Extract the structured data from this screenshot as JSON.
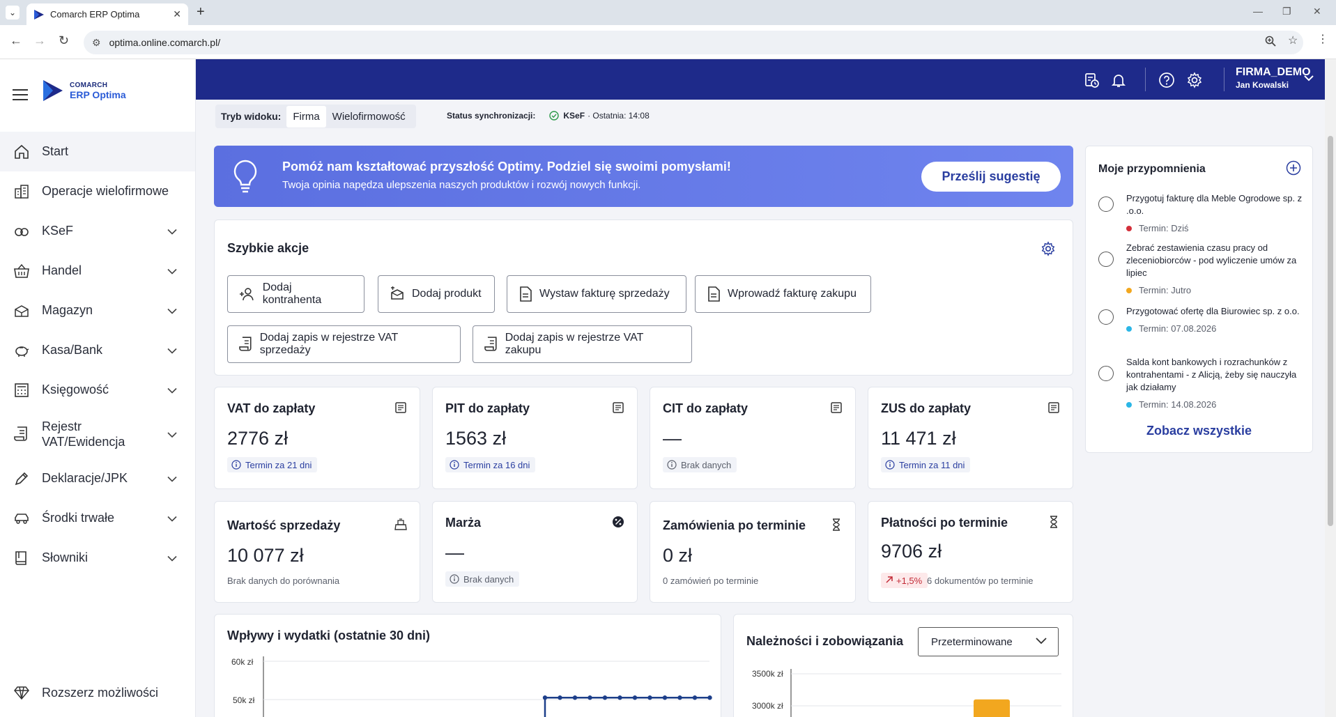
{
  "browser": {
    "tab_title": "Comarch ERP Optima",
    "url": "optima.online.comarch.pl/"
  },
  "logo": {
    "brand": "COMARCH",
    "product": "ERP Optima"
  },
  "sidebar": {
    "items": [
      {
        "label": "Start",
        "icon": "home-icon"
      },
      {
        "label": "Operacje wielofirmowe",
        "icon": "buildings-icon"
      },
      {
        "label": "KSeF",
        "icon": "ksef-icon"
      },
      {
        "label": "Handel",
        "icon": "basket-icon"
      },
      {
        "label": "Magazyn",
        "icon": "boxes-icon"
      },
      {
        "label": "Kasa/Bank",
        "icon": "piggybank-icon"
      },
      {
        "label": "Księgowość",
        "icon": "calculator-icon"
      },
      {
        "label": "Rejestr VAT/Ewidencja",
        "icon": "register-icon"
      },
      {
        "label": "Deklaracje/JPK",
        "icon": "pen-icon"
      },
      {
        "label": "Środki trwałe",
        "icon": "car-icon"
      },
      {
        "label": "Słowniki",
        "icon": "book-icon"
      }
    ],
    "bottom": "Rozszerz możliwości"
  },
  "header": {
    "company": "FIRMA_DEMO",
    "user": "Jan Kowalski"
  },
  "subheader": {
    "view_label": "Tryb widoku:",
    "view_options": [
      "Firma",
      "Wielofirmowość"
    ],
    "sync_label": "Status synchronizacji:",
    "sync_source": "KSeF",
    "sync_time": "· Ostatnia: 14:08"
  },
  "banner": {
    "title": "Pomóż nam kształtować przyszłość Optimy. Podziel się swoimi pomysłami!",
    "subtitle": "Twoja opinia napędza ulepszenia naszych produktów i rozwój nowych funkcji.",
    "cta": "Prześlij sugestię"
  },
  "quick_actions": {
    "title": "Szybkie akcje",
    "buttons": [
      "Dodaj kontrahenta",
      "Dodaj produkt",
      "Wystaw fakturę sprzedaży",
      "Wprowadź fakturę zakupu",
      "Dodaj zapis w rejestrze VAT sprzedaży",
      "Dodaj zapis w rejestrze VAT zakupu"
    ]
  },
  "kpis": [
    {
      "title": "VAT do zapłaty",
      "value": "2776 zł",
      "note": "Termin za 21 dni"
    },
    {
      "title": "PIT do zapłaty",
      "value": "1563 zł",
      "note": "Termin za 16 dni"
    },
    {
      "title": "CIT do zapłaty",
      "value": "—",
      "note": "Brak danych"
    },
    {
      "title": "ZUS do zapłaty",
      "value": "11 471 zł",
      "note": "Termin za 11 dni"
    },
    {
      "title": "Wartość sprzedaży",
      "value": "10 077 zł",
      "note": "Brak danych do porównania"
    },
    {
      "title": "Marża",
      "value": "—",
      "note": "Brak danych"
    },
    {
      "title": "Zamówienia po terminie",
      "value": "0 zł",
      "note": "0 zamówień po terminie"
    },
    {
      "title": "Płatności po terminie",
      "value": "9706 zł",
      "delta": "+1,5%",
      "note": "6 dokumentów po terminie"
    }
  ],
  "reminders": {
    "title": "Moje przypomnienia",
    "items": [
      {
        "text": "Przygotuj fakturę dla Meble Ogrodowe sp. z .o.o.",
        "due": "Termin: Dziś",
        "color": "#d32f3a"
      },
      {
        "text": "Zebrać zestawienia czasu pracy od zleceniobiorców - pod wyliczenie umów za lipiec",
        "due": "Termin: Jutro",
        "color": "#f2a71f"
      },
      {
        "text": "Przygotować ofertę dla Biurowiec sp. z o.o.",
        "due": "Termin: 07.08.2026",
        "color": "#2bb6e6"
      },
      {
        "text": "Salda kont bankowych i rozrachunków z kontrahentami - z Alicją, żeby się nauczyła jak działamy",
        "due": "Termin: 14.08.2026",
        "color": "#2bb6e6"
      }
    ],
    "see_all": "Zobacz wszystkie"
  },
  "chart_data": [
    {
      "type": "line",
      "title": "Wpływy i wydatki (ostatnie 30 dni)",
      "y_ticks": [
        "60k zł",
        "50k zł"
      ],
      "series": [
        {
          "values": [
            50500,
            50500,
            50500,
            50500,
            50500,
            50500,
            50500,
            50500,
            50500,
            50500,
            50500,
            50500
          ]
        }
      ]
    },
    {
      "type": "bar",
      "title": "Należności i zobowiązania",
      "filter": "Przeterminowane",
      "y_ticks": [
        "3500k zł",
        "3000k zł"
      ],
      "series": [
        {
          "values": [
            3100000
          ]
        }
      ]
    }
  ]
}
